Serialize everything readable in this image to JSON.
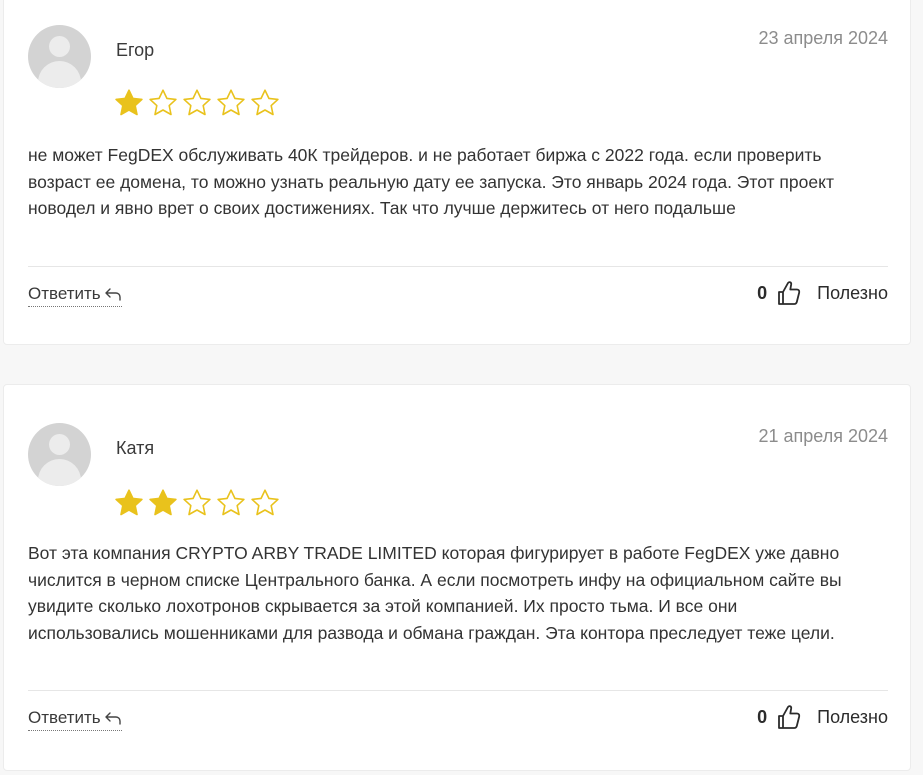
{
  "reviews": [
    {
      "author": "Егор",
      "date": "23 апреля 2024",
      "rating": 1,
      "max_rating": 5,
      "text": "не может FegDEX обслуживать 40К трейдеров. и не работает биржа с 2022 года. если проверить возраст ее домена, то можно узнать реальную дату ее запуска. Это январь 2024 года. Этот проект новодел и явно врет о своих достижениях. Так что лучше держитесь от него подальше",
      "reply_label": "Ответить",
      "useful_count": "0",
      "useful_label": "Полезно"
    },
    {
      "author": "Катя",
      "date": "21 апреля 2024",
      "rating": 2,
      "max_rating": 5,
      "text": "Вот эта компания CRYPTO ARBY TRADE LIMITED которая фигурирует в работе FegDEX уже давно числится в черном списке Центрального банка. А если посмотреть инфу на официальном сайте вы увидите сколько лохотронов скрывается за этой компанией. Их просто тьма. И все они использовались мошенниками для развода и обмана граждан. Эта контора преследует теже цели.",
      "reply_label": "Ответить",
      "useful_count": "0",
      "useful_label": "Полезно"
    }
  ],
  "colors": {
    "star_filled": "#e9c21c",
    "star_outline": "#e9c21c",
    "avatar_bg": "#d3d3d3"
  },
  "icons": {
    "reply": "reply-arrow-icon",
    "thumb": "thumbs-up-icon",
    "star": "star-icon",
    "avatar": "user-avatar-icon"
  }
}
